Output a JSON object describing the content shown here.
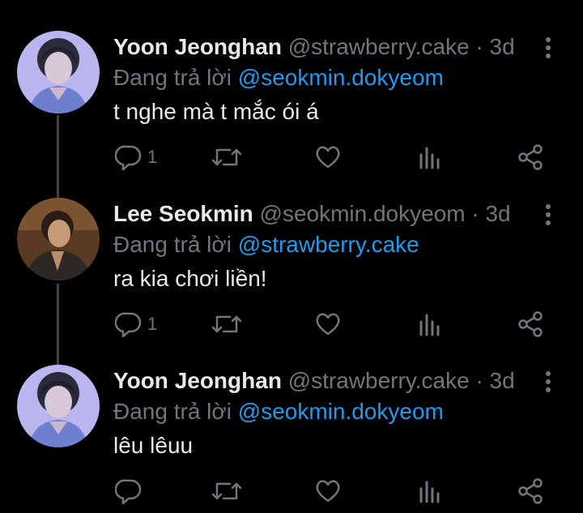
{
  "colors": {
    "background": "#000000",
    "name": "#e7e9ea",
    "muted": "#71767b",
    "link": "#1d9bf0",
    "thread_line": "#3e4144"
  },
  "tweets": [
    {
      "name": "Yoon Jeonghan",
      "handle": "@strawberry.cake",
      "time": "· 3d",
      "reply_prefix": "Đang trả lời",
      "reply_to": "@seokmin.dokyeom",
      "text": "t nghe mà t mắc ói á",
      "reply_count": "1"
    },
    {
      "name": "Lee Seokmin",
      "handle": "@seokmin.dokyeom",
      "time": "· 3d",
      "reply_prefix": "Đang trả lời",
      "reply_to": "@strawberry.cake",
      "text": "ra kia chơi liền!",
      "reply_count": "1"
    },
    {
      "name": "Yoon Jeonghan",
      "handle": "@strawberry.cake",
      "time": "· 3d",
      "reply_prefix": "Đang trả lời",
      "reply_to": "@seokmin.dokyeom",
      "text": "lêu lêuu",
      "reply_count": ""
    }
  ],
  "icons": {
    "reply": "reply-bubble-icon",
    "retweet": "retweet-icon",
    "like": "heart-icon",
    "views": "bar-chart-icon",
    "share": "share-icon",
    "more": "more-vertical-icon"
  }
}
